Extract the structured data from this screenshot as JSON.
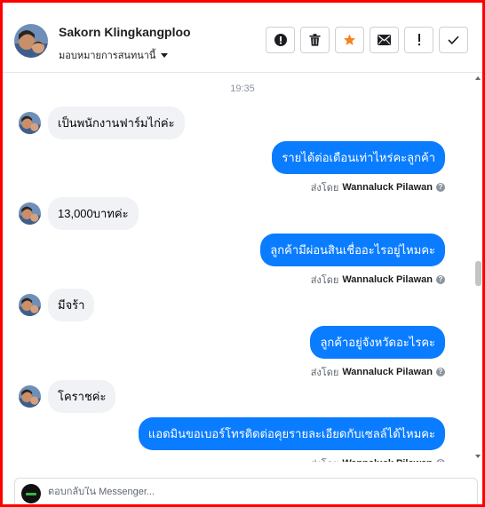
{
  "header": {
    "contact_name": "Sakorn Klingkangploo",
    "assign_label": "มอบหมายการสนทนานี้",
    "actions": [
      {
        "icon": "exclamation-circle-icon"
      },
      {
        "icon": "trash-icon"
      },
      {
        "icon": "star-icon"
      },
      {
        "icon": "envelope-icon"
      },
      {
        "icon": "exclamation-icon"
      },
      {
        "icon": "checkmark-icon"
      }
    ]
  },
  "thread": {
    "timestamp": "19:35",
    "sent_by_prefix": "ส่งโดย",
    "agent_name": "Wannaluck Pilawan",
    "messages": [
      {
        "direction": "in",
        "text": "เป็นพนักงานฟาร์มไก่ค่ะ"
      },
      {
        "direction": "out",
        "text": "รายได้ต่อเดือนเท่าไหร่คะลูกค้า"
      },
      {
        "direction": "in",
        "text": "13,000บาทค่ะ"
      },
      {
        "direction": "out",
        "text": "ลูกค้ามีผ่อนสินเชื่ออะไรอยู่ไหมคะ"
      },
      {
        "direction": "in",
        "text": "มีจร้า"
      },
      {
        "direction": "out",
        "text": "ลูกค้าอยู่จังหวัดอะไรคะ"
      },
      {
        "direction": "in",
        "text": "โคราชค่ะ"
      },
      {
        "direction": "out",
        "text": "แอดมินขอเบอร์โทรติดต่อคุยรายละเอียดกับเซลล์ได้ไหมคะ"
      }
    ]
  },
  "composer": {
    "placeholder": "ตอบกลับใน Messenger..."
  },
  "colors": {
    "frame": "#ff0000",
    "outgoing_bubble": "#0a7cff",
    "incoming_bubble": "#f0f2f5",
    "star_accent": "#f5821f"
  }
}
